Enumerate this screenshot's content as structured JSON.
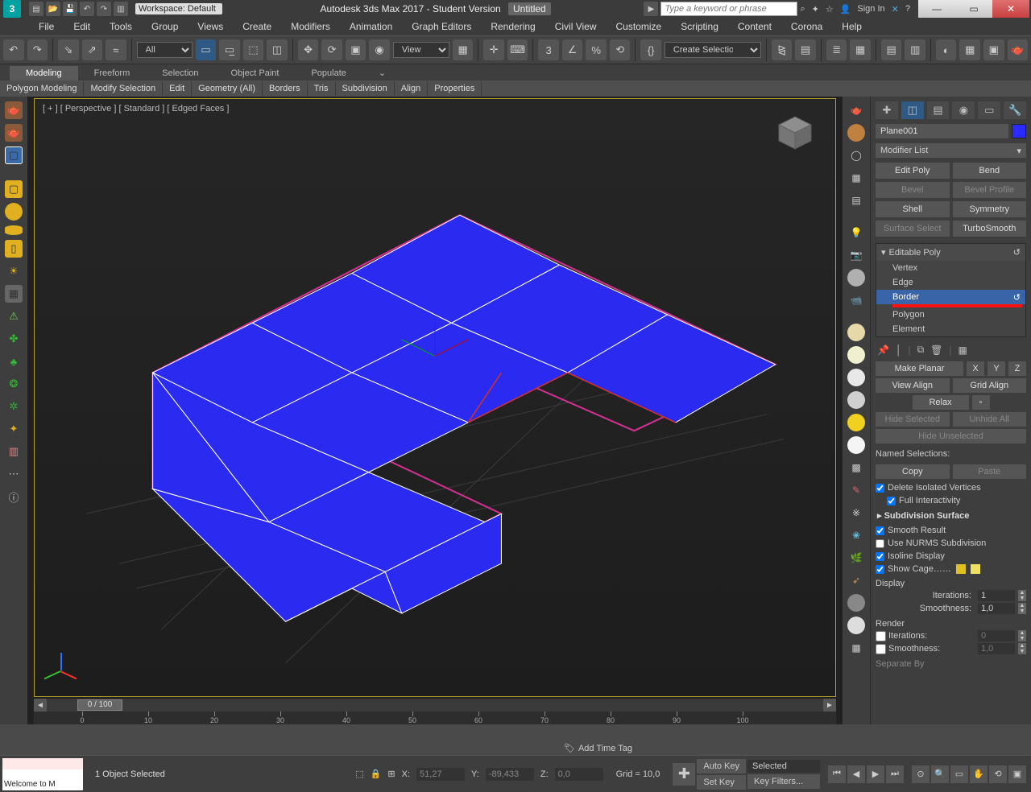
{
  "app": {
    "icon_label": "3",
    "workspace_dd": "Workspace: Default",
    "title": "Autodesk 3ds Max 2017 - Student Version",
    "doc": "Untitled",
    "search_placeholder": "Type a keyword or phrase",
    "signin": "Sign In"
  },
  "menubar": [
    "File",
    "Edit",
    "Tools",
    "Group",
    "Views",
    "Create",
    "Modifiers",
    "Animation",
    "Graph Editors",
    "Rendering",
    "Civil View",
    "Customize",
    "Scripting",
    "Content",
    "Corona",
    "Help"
  ],
  "toolbar": {
    "filter_dd": "All",
    "view_dd": "View",
    "named_sel_dd": "Create Selection Se"
  },
  "ribbon": {
    "tabs": [
      "Modeling",
      "Freeform",
      "Selection",
      "Object Paint",
      "Populate"
    ],
    "active_tab": 0,
    "sub": [
      "Polygon Modeling",
      "Modify Selection",
      "Edit",
      "Geometry (All)",
      "Borders",
      "Tris",
      "Subdivision",
      "Align",
      "Properties"
    ]
  },
  "viewport": {
    "label": "[ + ] [ Perspective ] [ Standard ] [ Edged Faces ]",
    "timeline_handle": "0 / 100",
    "ruler_ticks": [
      0,
      10,
      20,
      30,
      40,
      50,
      60,
      70,
      80,
      90,
      100
    ]
  },
  "cmd": {
    "object_name": "Plane001",
    "modlist_dd": "Modifier List",
    "mod_buttons": [
      {
        "label": "Edit Poly",
        "dim": false
      },
      {
        "label": "Bend",
        "dim": false
      },
      {
        "label": "Bevel",
        "dim": true
      },
      {
        "label": "Bevel Profile",
        "dim": true
      },
      {
        "label": "Shell",
        "dim": false
      },
      {
        "label": "Symmetry",
        "dim": false
      },
      {
        "label": "Surface Select",
        "dim": true
      },
      {
        "label": "TurboSmooth",
        "dim": false
      }
    ],
    "stack_header": "Editable Poly",
    "stack": [
      "Vertex",
      "Edge",
      "Border",
      "Polygon",
      "Element"
    ],
    "stack_selected": 2,
    "edit_rollout": {
      "make_planar": "Make Planar",
      "axes": [
        "X",
        "Y",
        "Z"
      ],
      "view_align": "View Align",
      "grid_align": "Grid Align",
      "relax": "Relax",
      "hide_sel": "Hide Selected",
      "unhide_all": "Unhide All",
      "hide_unsel": "Hide Unselected",
      "named_sel_label": "Named Selections:",
      "copy": "Copy",
      "paste": "Paste",
      "delete_iso": "Delete Isolated Vertices",
      "full_inter": "Full Interactivity"
    },
    "subsurf": {
      "header": "Subdivision Surface",
      "smooth_result": "Smooth Result",
      "use_nurms": "Use NURMS Subdivision",
      "isoline": "Isoline Display",
      "show_cage": "Show Cage……",
      "display_hdr": "Display",
      "iterations_label": "Iterations:",
      "iterations_val": "1",
      "smoothness_label": "Smoothness:",
      "smoothness_val": "1,0",
      "render_hdr": "Render",
      "r_iter_val": "0",
      "r_smooth_val": "1,0",
      "separate_hdr": "Separate By"
    }
  },
  "status": {
    "prompt": "Welcome to M",
    "selection": "1 Object Selected",
    "x_label": "X:",
    "x": "51,27",
    "y_label": "Y:",
    "y": "-89,433",
    "z_label": "Z:",
    "z": "0,0",
    "grid": "Grid = 10,0",
    "autokey": "Auto Key",
    "setkey": "Set Key",
    "selected_dd": "Selected",
    "keyfilters": "Key Filters...",
    "add_time_tag": "Add Time Tag"
  }
}
